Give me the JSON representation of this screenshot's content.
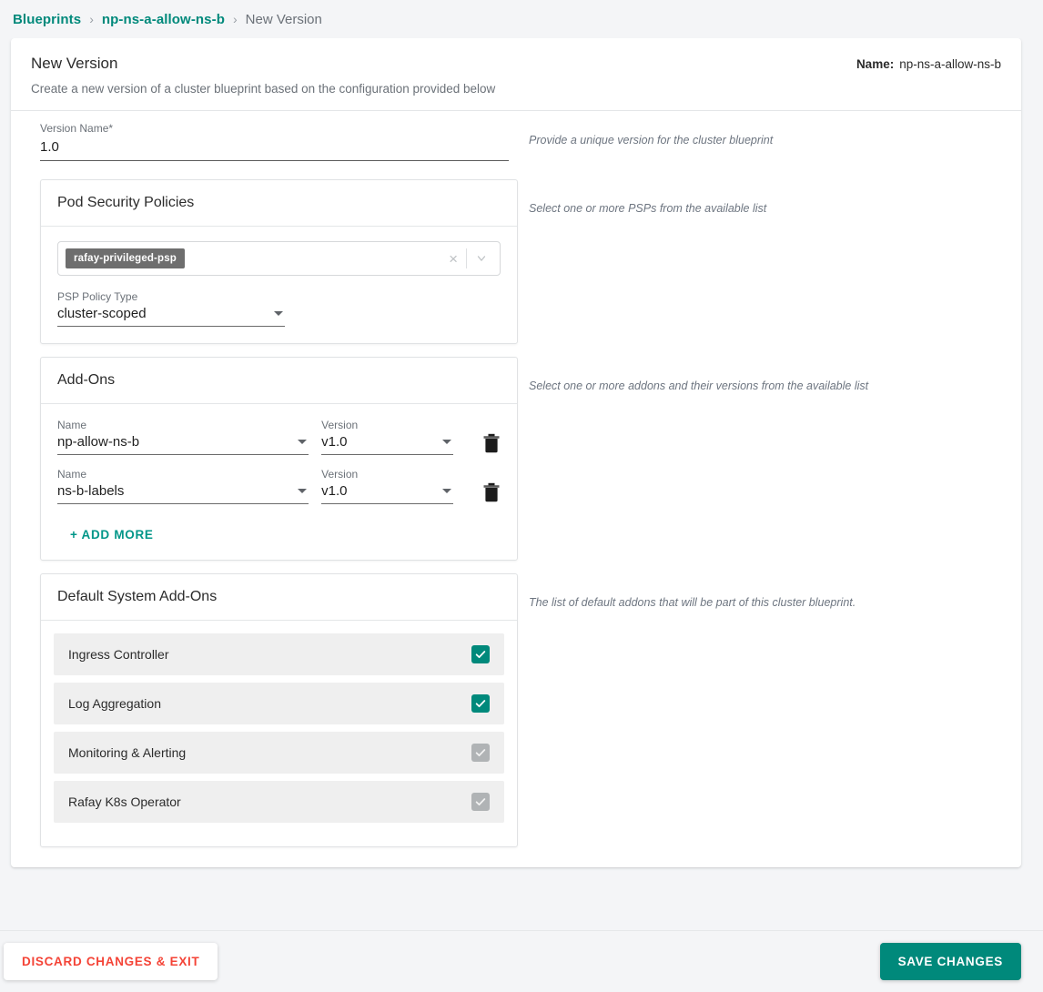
{
  "breadcrumb": {
    "items": [
      {
        "label": "Blueprints",
        "type": "link"
      },
      {
        "label": "np-ns-a-allow-ns-b",
        "type": "link"
      },
      {
        "label": "New Version",
        "type": "current"
      }
    ],
    "separator": "›"
  },
  "header": {
    "title": "New Version",
    "subtitle": "Create a new version of a cluster blueprint based on the configuration provided below",
    "name_label": "Name:",
    "name_value": "np-ns-a-allow-ns-b"
  },
  "version_name": {
    "label": "Version Name",
    "required_marker": "*",
    "value": "1.0",
    "placeholder": "Version Name",
    "hint": "Provide a unique version for the cluster blueprint"
  },
  "psp": {
    "title": "Pod Security Policies",
    "hint": "Select one or more PSPs from the available list",
    "chips": [
      "rafay-privileged-psp"
    ],
    "clear_icon": "×",
    "policy_type": {
      "label": "PSP Policy Type",
      "value": "cluster-scoped"
    }
  },
  "addons": {
    "title": "Add-Ons",
    "hint": "Select one or more addons and their versions from the available list",
    "name_label": "Name",
    "version_label": "Version",
    "rows": [
      {
        "name": "np-allow-ns-b",
        "version": "v1.0"
      },
      {
        "name": "ns-b-labels",
        "version": "v1.0"
      }
    ],
    "add_more_label": "+ ADD MORE"
  },
  "default_addons": {
    "title": "Default System Add-Ons",
    "hint": "The list of default addons that will be part of this cluster blueprint.",
    "items": [
      {
        "label": "Ingress Controller",
        "checked": true,
        "enabled": true
      },
      {
        "label": "Log Aggregation",
        "checked": true,
        "enabled": true
      },
      {
        "label": "Monitoring & Alerting",
        "checked": true,
        "enabled": false
      },
      {
        "label": "Rafay K8s Operator",
        "checked": true,
        "enabled": false
      }
    ]
  },
  "footer": {
    "discard_label": "DISCARD CHANGES & EXIT",
    "save_label": "SAVE CHANGES"
  },
  "colors": {
    "accent_teal": "#00897b",
    "danger_red": "#f44336",
    "chip_gray": "#6e6e6e",
    "page_bg": "#f4f5f7",
    "row_bg": "#efefef",
    "disabled_gray": "#b0b3b5"
  }
}
